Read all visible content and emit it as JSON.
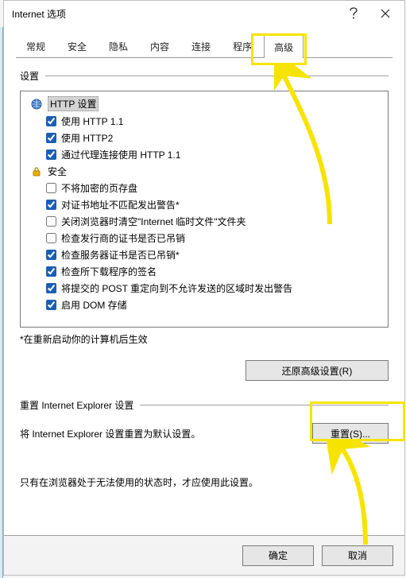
{
  "window": {
    "title": "Internet 选项"
  },
  "tabs": [
    "常规",
    "安全",
    "隐私",
    "内容",
    "连接",
    "程序",
    "高级"
  ],
  "active_tab_index": 6,
  "settings": {
    "legend": "设置",
    "groups": [
      {
        "type": "header",
        "icon": "globe-icon",
        "label": "HTTP 设置",
        "selected": true,
        "items": [
          {
            "checked": true,
            "label": "使用 HTTP 1.1"
          },
          {
            "checked": true,
            "label": "使用 HTTP2"
          },
          {
            "checked": true,
            "label": "通过代理连接使用 HTTP 1.1"
          }
        ]
      },
      {
        "type": "header",
        "icon": "lock-icon",
        "label": "安全",
        "selected": false,
        "items": [
          {
            "checked": false,
            "label": "不将加密的页存盘"
          },
          {
            "checked": true,
            "label": "对证书地址不匹配发出警告*"
          },
          {
            "checked": false,
            "label": "关闭浏览器时清空\"Internet 临时文件\"文件夹"
          },
          {
            "checked": false,
            "label": "检查发行商的证书是否已吊销"
          },
          {
            "checked": true,
            "label": "检查服务器证书是否已吊销*"
          },
          {
            "checked": true,
            "label": "检查所下载程序的签名"
          },
          {
            "checked": true,
            "label": "将提交的 POST 重定向到不允许发送的区域时发出警告"
          },
          {
            "checked": true,
            "label": "启用 DOM 存储"
          }
        ]
      }
    ],
    "note": "*在重新启动你的计算机后生效",
    "restore_button": "还原高级设置(R)"
  },
  "reset": {
    "legend": "重置 Internet Explorer 设置",
    "desc": "将 Internet Explorer 设置重置为默认设置。",
    "button": "重置(S)...",
    "hint": "只有在浏览器处于无法使用的状态时，才应使用此设置。"
  },
  "footer": {
    "ok": "确定",
    "cancel": "取消"
  }
}
